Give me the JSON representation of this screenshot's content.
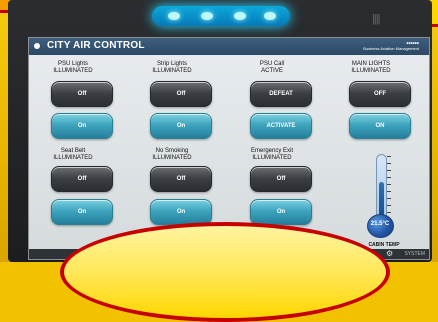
{
  "header": {
    "title": "CITY AIR CONTROL",
    "brand": "••••••",
    "brand_sub": "Business Aviation Management"
  },
  "controls": [
    {
      "label_1": "PSU Lights",
      "label_2": "ILLUMINATED",
      "top_button": "Off",
      "bottom_button": "On"
    },
    {
      "label_1": "Strip Lights",
      "label_2": "ILLUMINATED",
      "top_button": "Off",
      "bottom_button": "On"
    },
    {
      "label_1": "PSU Call",
      "label_2": "ACTIVE",
      "top_button": "DEFEAT",
      "bottom_button": "ACTIVATE"
    },
    {
      "label_1": "MAIN LIGHTS",
      "label_2": "ILLUMINATED",
      "top_button": "OFF",
      "bottom_button": "ON"
    },
    {
      "label_1": "Seat Belt",
      "label_2": "ILLUMINATED",
      "top_button": "Off",
      "bottom_button": "On"
    },
    {
      "label_1": "No Smoking",
      "label_2": "ILLUMINATED",
      "top_button": "Off",
      "bottom_button": "On"
    },
    {
      "label_1": "Emergency Exit",
      "label_2": "ILLUMINATED",
      "top_button": "Off",
      "bottom_button": "On"
    }
  ],
  "cabin": {
    "temperature": "21.5°C",
    "label": "CABIN TEMP",
    "level": 0.55
  },
  "footer": {
    "menu_icon": "menu-icon",
    "settings_icon": "gear-icon",
    "footer_text": "SYSTEM"
  }
}
